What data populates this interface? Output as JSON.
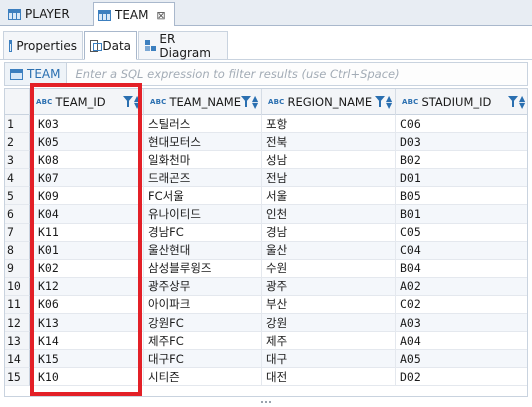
{
  "editor_tabs": [
    {
      "label": "PLAYER",
      "icon": "table-icon"
    },
    {
      "label": "TEAM",
      "icon": "table-icon",
      "active": true
    }
  ],
  "sub_tabs": [
    {
      "label": "Properties",
      "icon": "properties-icon"
    },
    {
      "label": "Data",
      "icon": "data-icon",
      "active": true
    },
    {
      "label": "ER Diagram",
      "icon": "er-diagram-icon"
    }
  ],
  "filter": {
    "label": "TEAM",
    "placeholder": "Enter a SQL expression to filter results (use Ctrl+Space)"
  },
  "grid": {
    "type_badge": "ABC",
    "columns": [
      "TEAM_ID",
      "TEAM_NAME",
      "REGION_NAME",
      "STADIUM_ID"
    ],
    "rows": [
      {
        "n": "1",
        "team_id": "K03",
        "team_name": "스틸러스",
        "region": "포항",
        "stadium": "C06"
      },
      {
        "n": "2",
        "team_id": "K05",
        "team_name": "현대모터스",
        "region": "전북",
        "stadium": "D03"
      },
      {
        "n": "3",
        "team_id": "K08",
        "team_name": "일화천마",
        "region": "성남",
        "stadium": "B02"
      },
      {
        "n": "4",
        "team_id": "K07",
        "team_name": "드래곤즈",
        "region": "전남",
        "stadium": "D01"
      },
      {
        "n": "5",
        "team_id": "K09",
        "team_name": "FC서울",
        "region": "서울",
        "stadium": "B05"
      },
      {
        "n": "6",
        "team_id": "K04",
        "team_name": "유나이티드",
        "region": "인천",
        "stadium": "B01"
      },
      {
        "n": "7",
        "team_id": "K11",
        "team_name": "경남FC",
        "region": "경남",
        "stadium": "C05"
      },
      {
        "n": "8",
        "team_id": "K01",
        "team_name": "울산현대",
        "region": "울산",
        "stadium": "C04"
      },
      {
        "n": "9",
        "team_id": "K02",
        "team_name": "삼성블루윙즈",
        "region": "수원",
        "stadium": "B04"
      },
      {
        "n": "10",
        "team_id": "K12",
        "team_name": "광주상무",
        "region": "광주",
        "stadium": "A02"
      },
      {
        "n": "11",
        "team_id": "K06",
        "team_name": "아이파크",
        "region": "부산",
        "stadium": "C02"
      },
      {
        "n": "12",
        "team_id": "K13",
        "team_name": "강원FC",
        "region": "강원",
        "stadium": "A03"
      },
      {
        "n": "13",
        "team_id": "K14",
        "team_name": "제주FC",
        "region": "제주",
        "stadium": "A04"
      },
      {
        "n": "14",
        "team_id": "K15",
        "team_name": "대구FC",
        "region": "대구",
        "stadium": "A05"
      },
      {
        "n": "15",
        "team_id": "K10",
        "team_name": "시티즌",
        "region": "대전",
        "stadium": "D02"
      }
    ]
  },
  "colors": {
    "accent": "#2a6fb0",
    "highlight_box": "#e32027",
    "alt_row": "#f4f7fb"
  }
}
